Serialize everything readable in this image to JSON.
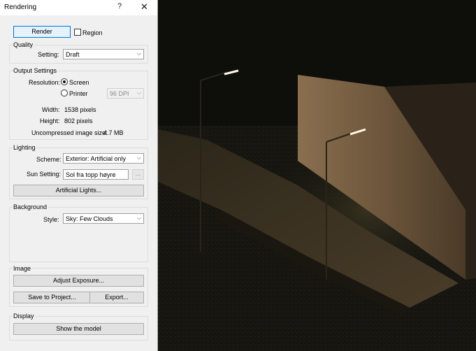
{
  "dialog": {
    "title": "Rendering",
    "help_glyph": "?",
    "close_glyph": "✕"
  },
  "render": {
    "button_label": "Render",
    "region_label": "Region",
    "region_checked": false
  },
  "quality": {
    "group_label": "Quality",
    "setting_label": "Setting:",
    "setting_value": "Draft"
  },
  "output": {
    "group_label": "Output Settings",
    "resolution_label": "Resolution:",
    "screen_label": "Screen",
    "printer_label": "Printer",
    "selected": "Screen",
    "dpi_value": "96 DPI",
    "width_label": "Width:",
    "width_value": "1538 pixels",
    "height_label": "Height:",
    "height_value": "802 pixels",
    "size_label": "Uncompressed image size:",
    "size_value": "4.7 MB"
  },
  "lighting": {
    "group_label": "Lighting",
    "scheme_label": "Scheme:",
    "scheme_value": "Exterior: Artificial only",
    "sun_label": "Sun Setting:",
    "sun_value": "Sol fra topp høyre",
    "sun_browse": "...",
    "artificial_button": "Artificial Lights..."
  },
  "background": {
    "group_label": "Background",
    "style_label": "Style:",
    "style_value": "Sky: Few Clouds"
  },
  "image": {
    "group_label": "Image",
    "adjust_button": "Adjust Exposure...",
    "save_button": "Save to Project...",
    "export_button": "Export..."
  },
  "display": {
    "group_label": "Display",
    "show_button": "Show the model"
  },
  "colors": {
    "viewport_bg": "#0e0e0b",
    "wall_lit": "#7d6447",
    "wall_dark": "#2a2218",
    "lamp_light": "#fff8e8"
  }
}
